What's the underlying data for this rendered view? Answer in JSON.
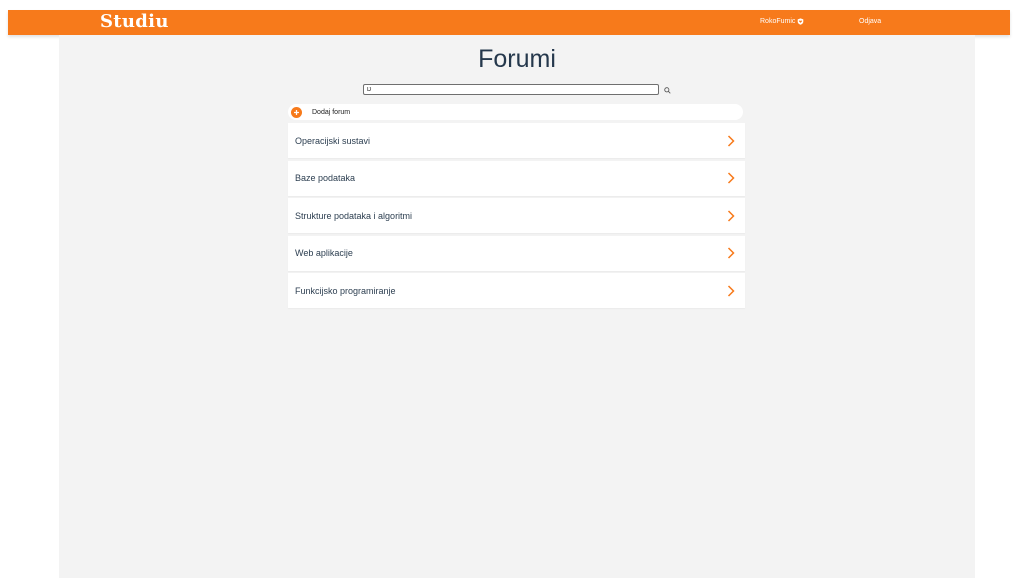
{
  "navbar": {
    "brand": "Studiu",
    "username": "RokoFumic",
    "user_badge_icon": "shield-heart-icon",
    "logout_label": "Odjava",
    "color": "#f77a1b"
  },
  "main": {
    "title": "Forumi",
    "search": {
      "value": "D",
      "placeholder": "",
      "icon": "search-icon"
    },
    "add_forum": {
      "label": "Dodaj forum",
      "icon": "plus-circle-icon"
    },
    "forums": [
      {
        "name": "Operacijski sustavi"
      },
      {
        "name": "Baze podataka"
      },
      {
        "name": "Strukture podataka i algoritmi"
      },
      {
        "name": "Web aplikacije"
      },
      {
        "name": "Funkcijsko programiranje"
      }
    ]
  },
  "colors": {
    "accent": "#f77a1b",
    "background": "#f3f3f3",
    "text": "#25384c"
  }
}
